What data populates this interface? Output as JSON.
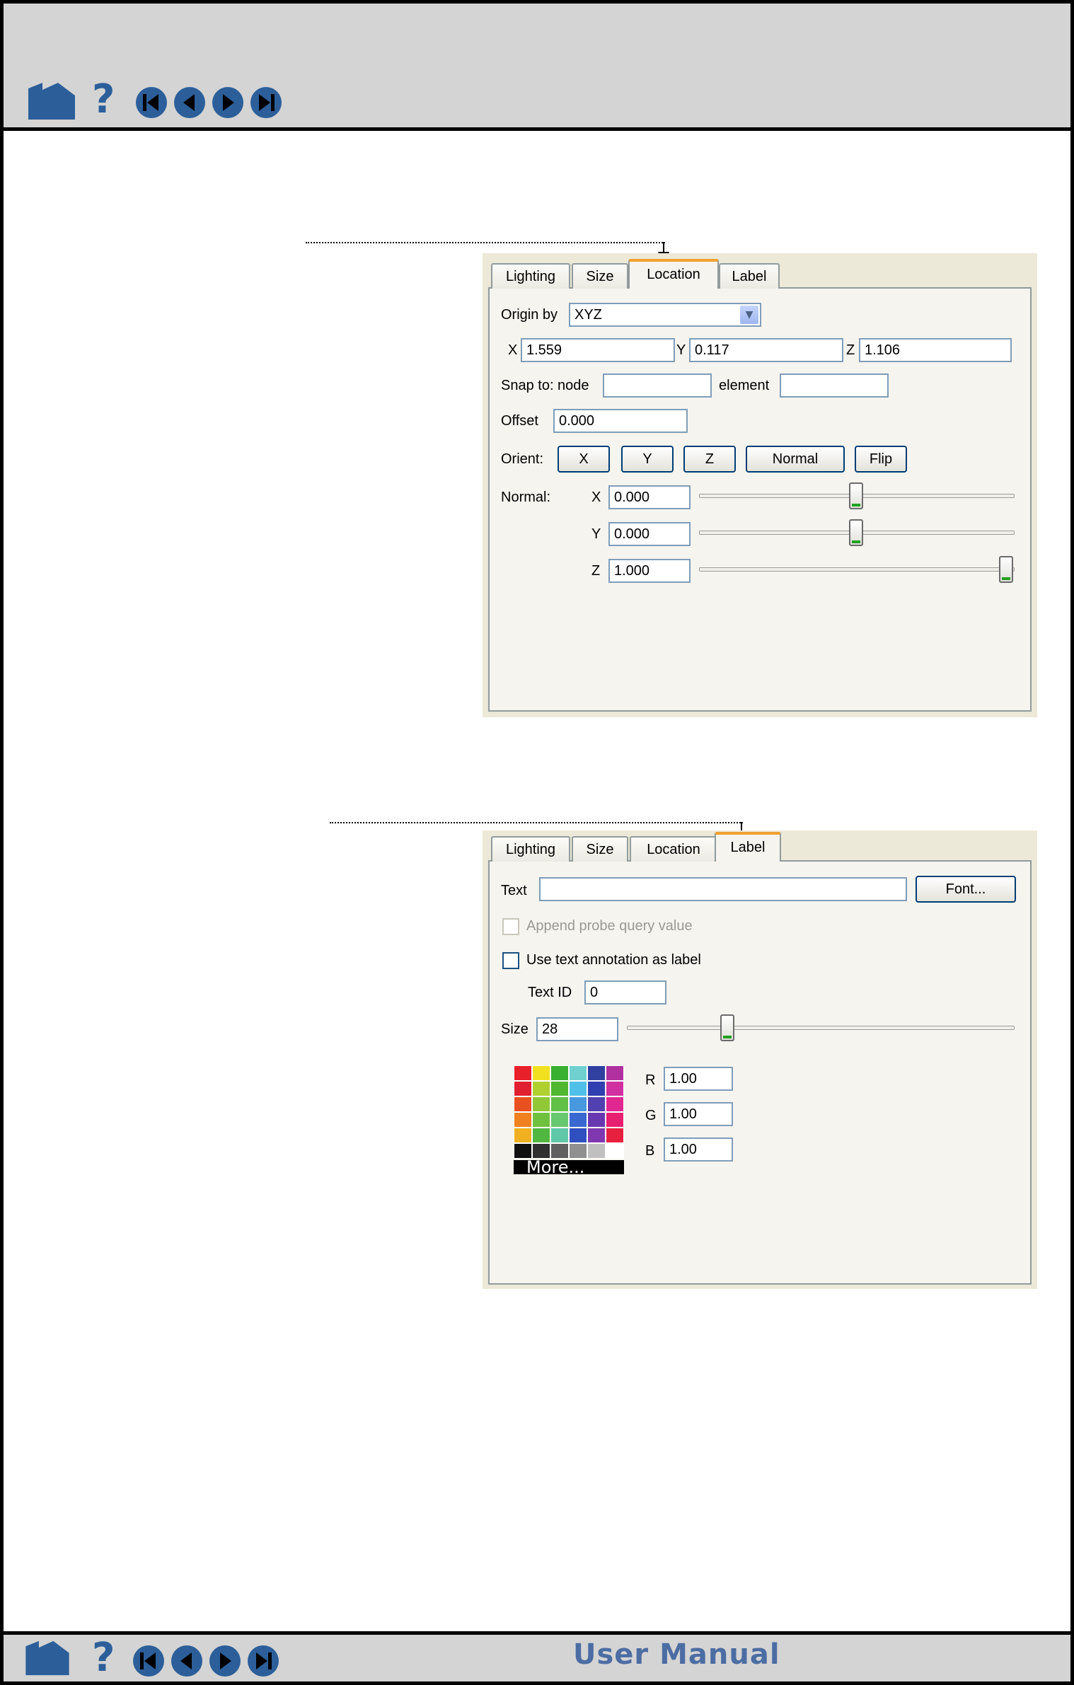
{
  "nav": {
    "home_icon": "home-icon",
    "help_glyph": "?",
    "buttons": [
      "first-page-icon",
      "previous-page-icon",
      "next-page-icon",
      "last-page-icon"
    ]
  },
  "footer": {
    "title": "User Manual"
  },
  "location_panel": {
    "tabs": [
      "Lighting",
      "Size",
      "Location",
      "Label"
    ],
    "active_tab": "Location",
    "origin_by_label": "Origin by",
    "origin_by_value": "XYZ",
    "x_label": "X",
    "x_value": "1.559",
    "y_label": "Y",
    "y_value": "0.117",
    "z_label": "Z",
    "z_value": "1.106",
    "snap_label": "Snap to: node",
    "snap_node_value": "",
    "element_label": "element",
    "element_value": "",
    "offset_label": "Offset",
    "offset_value": "0.000",
    "orient_label": "Orient:",
    "orient_buttons": [
      "X",
      "Y",
      "Z",
      "Normal",
      "Flip"
    ],
    "normal_label": "Normal:",
    "normal": [
      {
        "axis": "X",
        "value": "0.000",
        "level": 0.5
      },
      {
        "axis": "Y",
        "value": "0.000",
        "level": 0.5
      },
      {
        "axis": "Z",
        "value": "1.000",
        "level": 1.0
      }
    ]
  },
  "label_panel": {
    "tabs": [
      "Lighting",
      "Size",
      "Location",
      "Label"
    ],
    "active_tab": "Label",
    "text_label": "Text",
    "text_value": "",
    "font_button": "Font...",
    "append_label": "Append probe query value",
    "append_checked": false,
    "append_enabled": false,
    "use_annotation_label": "Use text annotation as label",
    "use_annotation_checked": false,
    "text_id_label": "Text ID",
    "text_id_value": "0",
    "size_label": "Size",
    "size_value": "28",
    "size_level": 0.25,
    "r_label": "R",
    "r_value": "1.00",
    "g_label": "G",
    "g_value": "1.00",
    "b_label": "B",
    "b_value": "1.00",
    "more_label": "More...",
    "palette": [
      [
        "#e8202a",
        "#f0e020",
        "#38b030",
        "#70d0d0",
        "#3040a0",
        "#b030a0"
      ],
      [
        "#e02030",
        "#b0d030",
        "#50b830",
        "#50c0e8",
        "#3040b0",
        "#d030a0"
      ],
      [
        "#e85020",
        "#90c838",
        "#60c048",
        "#4898e0",
        "#5040b0",
        "#e02890"
      ],
      [
        "#f08020",
        "#70c040",
        "#68c870",
        "#3868d0",
        "#6838b0",
        "#e82070"
      ],
      [
        "#f0b020",
        "#50b840",
        "#60c8a8",
        "#3050c0",
        "#8038b0",
        "#e82040"
      ],
      [
        "#101010",
        "#303030",
        "#606060",
        "#909090",
        "#c0c0c0",
        "#ffffff"
      ]
    ]
  }
}
